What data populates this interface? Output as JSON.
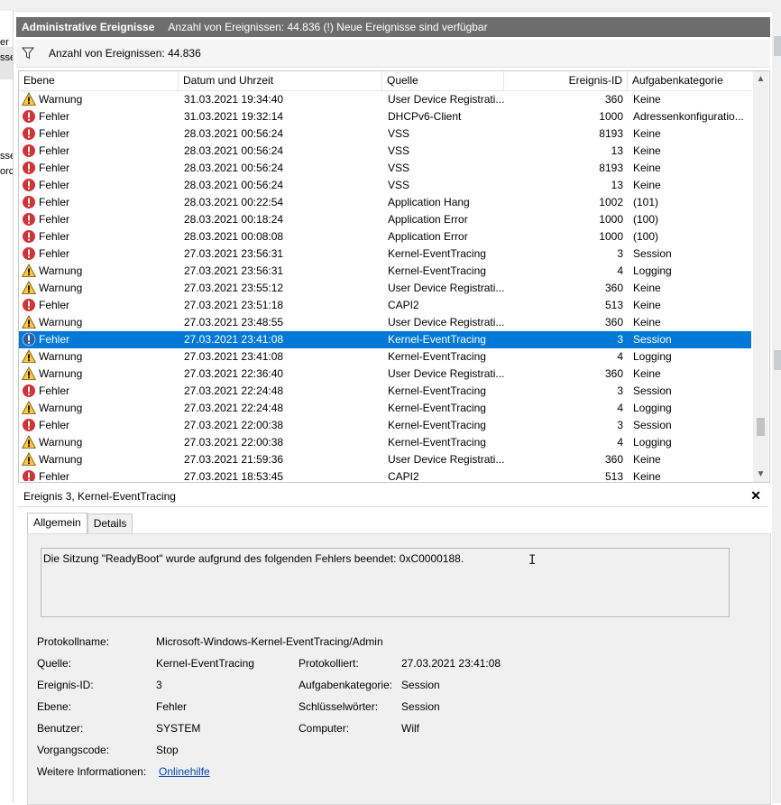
{
  "header": {
    "title": "Administrative Ereignisse",
    "info": "Anzahl von Ereignissen: 44.836 (!) Neue Ereignisse sind verfügbar"
  },
  "filter": {
    "text": "Anzahl von Ereignissen: 44.836"
  },
  "table": {
    "columns": [
      "Ebene",
      "Datum und Uhrzeit",
      "Quelle",
      "Ereignis-ID",
      "Aufgabenkategorie"
    ],
    "rows": [
      {
        "level": "Warnung",
        "icon": "warning-icon",
        "date": "31.03.2021 19:34:40",
        "source": "User Device Registrati...",
        "id": "360",
        "category": "Keine"
      },
      {
        "level": "Fehler",
        "icon": "error-icon",
        "date": "31.03.2021 19:32:14",
        "source": "DHCPv6-Client",
        "id": "1000",
        "category": "Adressenkonfiguratio..."
      },
      {
        "level": "Fehler",
        "icon": "error-icon",
        "date": "28.03.2021 00:56:24",
        "source": "VSS",
        "id": "8193",
        "category": "Keine"
      },
      {
        "level": "Fehler",
        "icon": "error-icon",
        "date": "28.03.2021 00:56:24",
        "source": "VSS",
        "id": "13",
        "category": "Keine"
      },
      {
        "level": "Fehler",
        "icon": "error-icon",
        "date": "28.03.2021 00:56:24",
        "source": "VSS",
        "id": "8193",
        "category": "Keine"
      },
      {
        "level": "Fehler",
        "icon": "error-icon",
        "date": "28.03.2021 00:56:24",
        "source": "VSS",
        "id": "13",
        "category": "Keine"
      },
      {
        "level": "Fehler",
        "icon": "error-icon",
        "date": "28.03.2021 00:22:54",
        "source": "Application Hang",
        "id": "1002",
        "category": "(101)"
      },
      {
        "level": "Fehler",
        "icon": "error-icon",
        "date": "28.03.2021 00:18:24",
        "source": "Application Error",
        "id": "1000",
        "category": "(100)"
      },
      {
        "level": "Fehler",
        "icon": "error-icon",
        "date": "28.03.2021 00:08:08",
        "source": "Application Error",
        "id": "1000",
        "category": "(100)"
      },
      {
        "level": "Fehler",
        "icon": "error-icon",
        "date": "27.03.2021 23:56:31",
        "source": "Kernel-EventTracing",
        "id": "3",
        "category": "Session"
      },
      {
        "level": "Warnung",
        "icon": "warning-icon",
        "date": "27.03.2021 23:56:31",
        "source": "Kernel-EventTracing",
        "id": "4",
        "category": "Logging"
      },
      {
        "level": "Warnung",
        "icon": "warning-icon",
        "date": "27.03.2021 23:55:12",
        "source": "User Device Registrati...",
        "id": "360",
        "category": "Keine"
      },
      {
        "level": "Fehler",
        "icon": "error-icon",
        "date": "27.03.2021 23:51:18",
        "source": "CAPI2",
        "id": "513",
        "category": "Keine"
      },
      {
        "level": "Warnung",
        "icon": "warning-icon",
        "date": "27.03.2021 23:48:55",
        "source": "User Device Registrati...",
        "id": "360",
        "category": "Keine"
      },
      {
        "level": "Fehler",
        "icon": "error-icon",
        "date": "27.03.2021 23:41:08",
        "source": "Kernel-EventTracing",
        "id": "3",
        "category": "Session",
        "selected": true
      },
      {
        "level": "Warnung",
        "icon": "warning-icon",
        "date": "27.03.2021 23:41:08",
        "source": "Kernel-EventTracing",
        "id": "4",
        "category": "Logging"
      },
      {
        "level": "Warnung",
        "icon": "warning-icon",
        "date": "27.03.2021 22:36:40",
        "source": "User Device Registrati...",
        "id": "360",
        "category": "Keine"
      },
      {
        "level": "Fehler",
        "icon": "error-icon",
        "date": "27.03.2021 22:24:48",
        "source": "Kernel-EventTracing",
        "id": "3",
        "category": "Session"
      },
      {
        "level": "Warnung",
        "icon": "warning-icon",
        "date": "27.03.2021 22:24:48",
        "source": "Kernel-EventTracing",
        "id": "4",
        "category": "Logging"
      },
      {
        "level": "Fehler",
        "icon": "error-icon",
        "date": "27.03.2021 22:00:38",
        "source": "Kernel-EventTracing",
        "id": "3",
        "category": "Session"
      },
      {
        "level": "Warnung",
        "icon": "warning-icon",
        "date": "27.03.2021 22:00:38",
        "source": "Kernel-EventTracing",
        "id": "4",
        "category": "Logging"
      },
      {
        "level": "Warnung",
        "icon": "warning-icon",
        "date": "27.03.2021 21:59:36",
        "source": "User Device Registrati...",
        "id": "360",
        "category": "Keine"
      },
      {
        "level": "Fehler",
        "icon": "error-icon",
        "date": "27.03.2021 18:53:45",
        "source": "CAPI2",
        "id": "513",
        "category": "Keine"
      }
    ]
  },
  "detail": {
    "title": "Ereignis 3, Kernel-EventTracing",
    "tabs": [
      "Allgemein",
      "Details"
    ],
    "message": "Die Sitzung \"ReadyBoot\" wurde aufgrund des folgenden Fehlers beendet: 0xC0000188.",
    "fields": {
      "protokollname_label": "Protokollname:",
      "protokollname": "Microsoft-Windows-Kernel-EventTracing/Admin",
      "quelle_label": "Quelle:",
      "quelle": "Kernel-EventTracing",
      "protokolliert_label": "Protokolliert:",
      "protokolliert": "27.03.2021 23:41:08",
      "id_label": "Ereignis-ID:",
      "id": "3",
      "kategorie_label": "Aufgabenkategorie:",
      "kategorie": "Session",
      "ebene_label": "Ebene:",
      "ebene": "Fehler",
      "schluessel_label": "Schlüsselwörter:",
      "schluessel": "Session",
      "benutzer_label": "Benutzer:",
      "benutzer": "SYSTEM",
      "computer_label": "Computer:",
      "computer": "Wilf",
      "vorgang_label": "Vorgangscode:",
      "vorgang": "Stop",
      "info_label": "Weitere Informationen:",
      "info_link": "Onlinehilfe"
    }
  },
  "left_fragments": [
    "er",
    "sse",
    "sse",
    "orc"
  ],
  "colors": {
    "header_bg": "#6d6d6d",
    "selection": "#0078d7",
    "error": "#d13438",
    "warning": "#ffc83d"
  }
}
